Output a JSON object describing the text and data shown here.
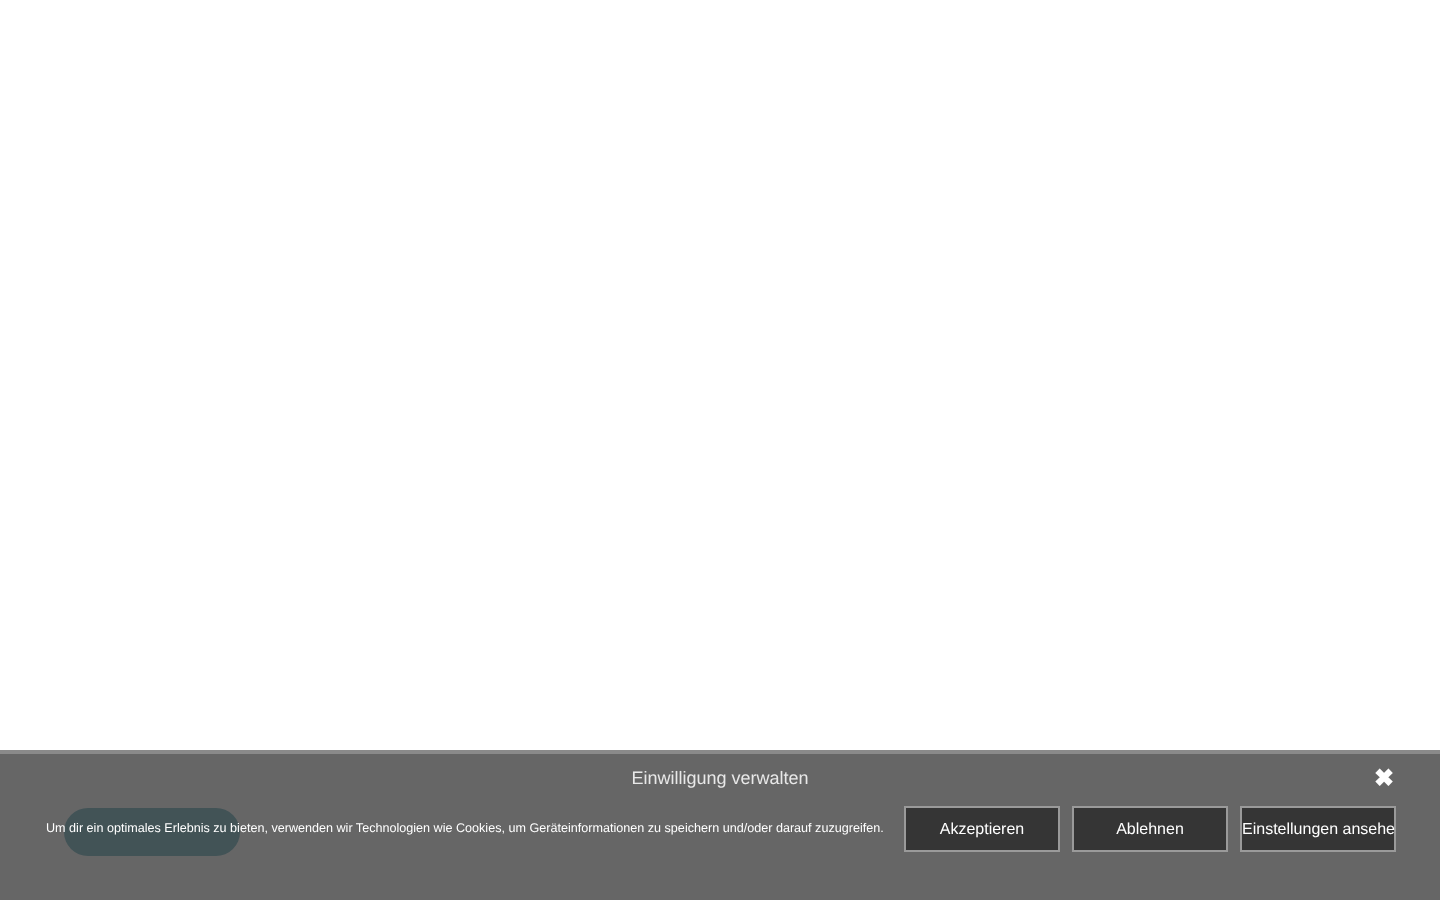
{
  "banner": {
    "title": "Einwilligung verwalten",
    "message": "Um dir ein optimales Erlebnis zu bieten, verwenden wir Technologien wie Cookies, um Geräteinformationen zu speichern und/oder darauf zuzugreifen.",
    "close": "✖",
    "buttons": [
      "Akzeptieren",
      "Ablehnen",
      "Einstellungen ansehe"
    ]
  }
}
